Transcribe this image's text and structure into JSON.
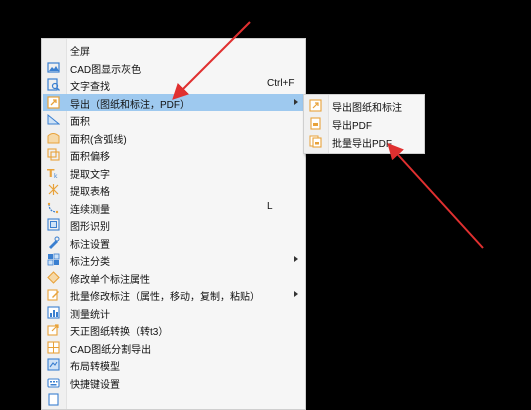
{
  "menu": {
    "items": [
      {
        "label": "全屏",
        "shortcut": "",
        "icon": "none-icon",
        "submenu": false
      },
      {
        "label": "CAD图显示灰色",
        "shortcut": "",
        "icon": "image-gray-icon",
        "submenu": false
      },
      {
        "label": "文字查找",
        "shortcut": "Ctrl+F",
        "icon": "text-search-icon",
        "submenu": false
      },
      {
        "label": "导出（图纸和标注，PDF）",
        "shortcut": "",
        "icon": "export-icon",
        "submenu": true,
        "highlighted": true
      },
      {
        "label": "面积",
        "shortcut": "",
        "icon": "area-icon",
        "submenu": false
      },
      {
        "label": "面积(含弧线)",
        "shortcut": "",
        "icon": "area-arc-icon",
        "submenu": false
      },
      {
        "label": "面积偏移",
        "shortcut": "",
        "icon": "area-offset-icon",
        "submenu": false
      },
      {
        "label": "提取文字",
        "shortcut": "",
        "icon": "extract-text-icon",
        "submenu": false
      },
      {
        "label": "提取表格",
        "shortcut": "",
        "icon": "extract-table-icon",
        "submenu": false
      },
      {
        "label": "连续测量",
        "shortcut": "L",
        "icon": "continuous-measure-icon",
        "submenu": false
      },
      {
        "label": "图形识别",
        "shortcut": "",
        "icon": "shape-recognize-icon",
        "submenu": false
      },
      {
        "label": "标注设置",
        "shortcut": "",
        "icon": "annotation-settings-icon",
        "submenu": false
      },
      {
        "label": "标注分类",
        "shortcut": "",
        "icon": "annotation-category-icon",
        "submenu": true
      },
      {
        "label": "修改单个标注属性",
        "shortcut": "",
        "icon": "edit-annotation-icon",
        "submenu": false
      },
      {
        "label": "批量修改标注（属性，移动，复制，粘贴）",
        "shortcut": "",
        "icon": "batch-edit-icon",
        "submenu": true
      },
      {
        "label": "测量统计",
        "shortcut": "",
        "icon": "measure-stats-icon",
        "submenu": false
      },
      {
        "label": "天正图纸转换（转t3）",
        "shortcut": "",
        "icon": "convert-t3-icon",
        "submenu": false
      },
      {
        "label": "CAD图纸分割导出",
        "shortcut": "",
        "icon": "split-export-icon",
        "submenu": false
      },
      {
        "label": "布局转模型",
        "shortcut": "",
        "icon": "layout-to-model-icon",
        "submenu": false
      },
      {
        "label": "快捷键设置",
        "shortcut": "",
        "icon": "shortcut-settings-icon",
        "submenu": false
      }
    ]
  },
  "submenu": {
    "items": [
      {
        "label": "导出图纸和标注",
        "icon": "export-drawing-icon"
      },
      {
        "label": "导出PDF",
        "icon": "export-pdf-icon"
      },
      {
        "label": "批量导出PDF",
        "icon": "batch-export-pdf-icon"
      }
    ]
  },
  "colors": {
    "background": "#000000",
    "menu_bg": "#f6f6f6",
    "highlight": "#9ec9ef",
    "icon_blue": "#3a7fd0",
    "icon_orange": "#e8a23a",
    "annotation_red": "#e03030"
  }
}
